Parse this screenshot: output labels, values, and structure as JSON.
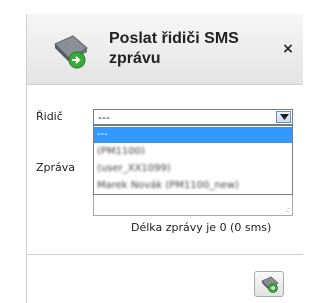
{
  "dialog": {
    "title": "Poslat řidiči SMS zprávu",
    "close_label": "×",
    "header_icon": "sms-phone-icon"
  },
  "form": {
    "driver_label": "Řidič",
    "driver_value": "---",
    "message_label": "Zpráva",
    "message_value": "",
    "length_info": "Délka zprávy je 0 (0 sms)"
  },
  "dropdown": {
    "options": [
      "---",
      "(PM1100)",
      "(user_XX1099)",
      "Marek Novák (PM1100_new)"
    ],
    "selected_index": 0
  },
  "send_button": {
    "icon": "send-sms-icon"
  },
  "colors": {
    "selection": "#3399ff",
    "send_green": "#3aa83a"
  }
}
